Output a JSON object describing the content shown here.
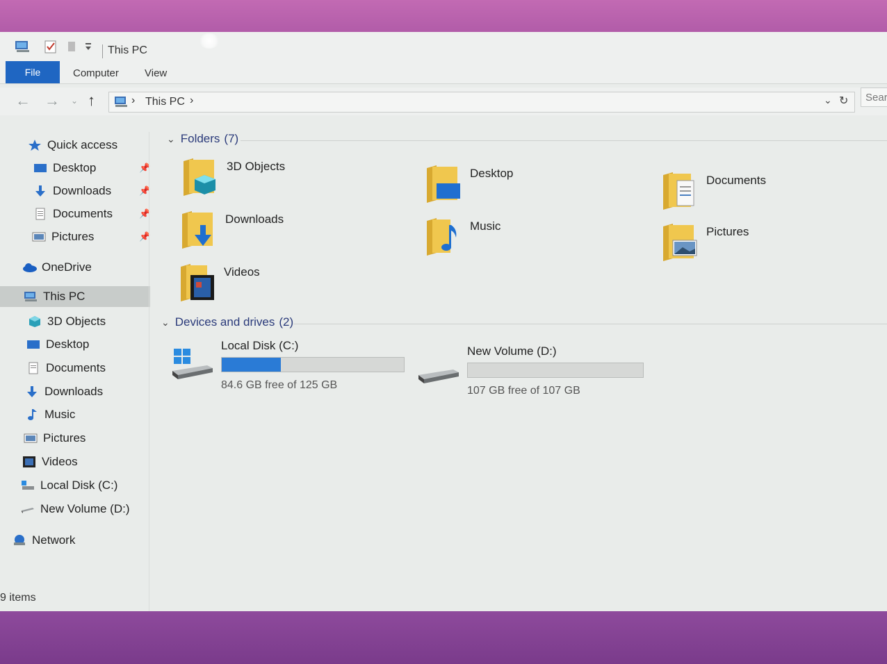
{
  "window": {
    "title": "This PC"
  },
  "ribbon": {
    "tabs": [
      "File",
      "Computer",
      "View"
    ]
  },
  "address": {
    "path": "This PC",
    "search_placeholder": "Sear"
  },
  "sidebar": {
    "quick_access": "Quick access",
    "quick_items": [
      {
        "label": "Desktop",
        "icon": "desktop-icon"
      },
      {
        "label": "Downloads",
        "icon": "downloads-icon"
      },
      {
        "label": "Documents",
        "icon": "documents-icon"
      },
      {
        "label": "Pictures",
        "icon": "pictures-icon"
      }
    ],
    "onedrive": "OneDrive",
    "this_pc": "This PC",
    "pc_items": [
      {
        "label": "3D Objects",
        "icon": "cube-icon"
      },
      {
        "label": "Desktop",
        "icon": "desktop-icon"
      },
      {
        "label": "Documents",
        "icon": "documents-icon"
      },
      {
        "label": "Downloads",
        "icon": "downloads-icon"
      },
      {
        "label": "Music",
        "icon": "music-icon"
      },
      {
        "label": "Pictures",
        "icon": "pictures-icon"
      },
      {
        "label": "Videos",
        "icon": "videos-icon"
      },
      {
        "label": "Local Disk (C:)",
        "icon": "local-disk-icon"
      },
      {
        "label": "New Volume (D:)",
        "icon": "drive-icon"
      }
    ],
    "network": "Network"
  },
  "content": {
    "folders_header": "Folders",
    "folders_count": "(7)",
    "folders": [
      {
        "label": "3D Objects"
      },
      {
        "label": "Desktop"
      },
      {
        "label": "Documents"
      },
      {
        "label": "Downloads"
      },
      {
        "label": "Music"
      },
      {
        "label": "Pictures"
      },
      {
        "label": "Videos"
      }
    ],
    "devices_header": "Devices and drives",
    "devices_count": "(2)",
    "drives": [
      {
        "label": "Local Disk (C:)",
        "free_text": "84.6 GB free of 125 GB",
        "used_fraction": 0.3232
      },
      {
        "label": "New Volume (D:)",
        "free_text": "107 GB free of 107 GB",
        "used_fraction": 0.0
      }
    ]
  },
  "status": {
    "items": "9 items"
  },
  "colors": {
    "accent": "#1f66c2",
    "bar_fill": "#2a7bd6",
    "folder": "#e8c04a"
  }
}
